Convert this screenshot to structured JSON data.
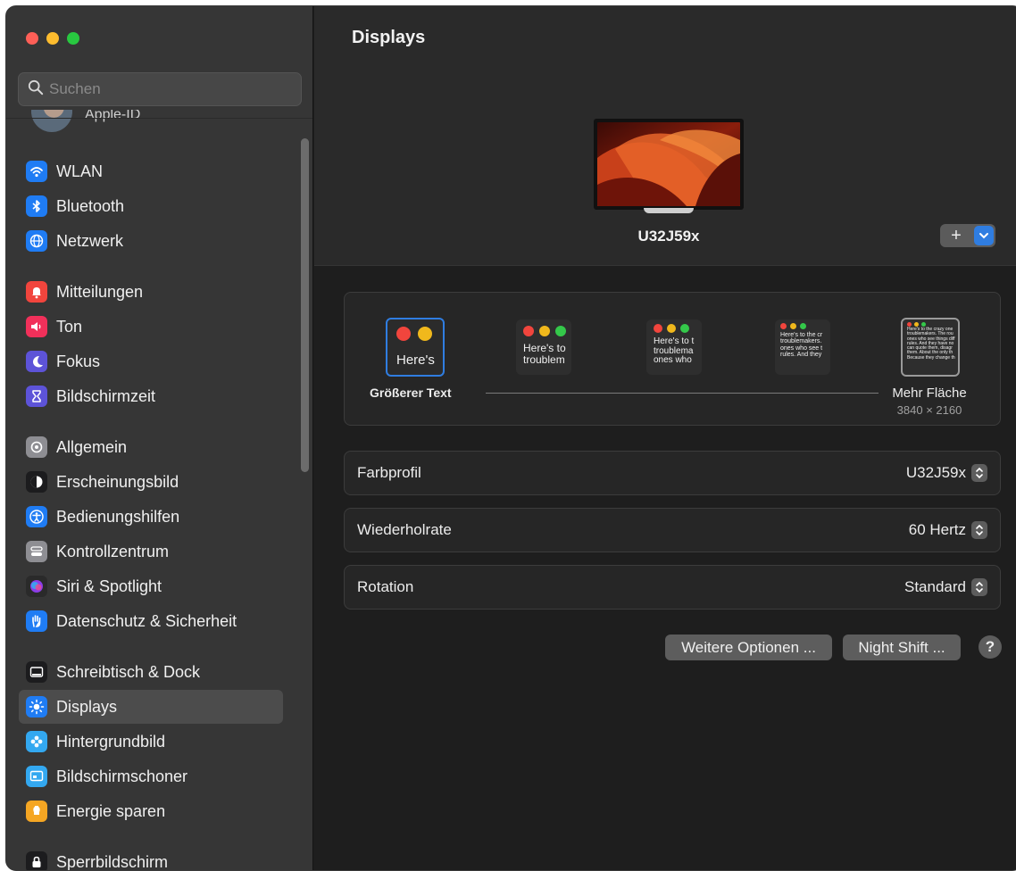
{
  "window": {
    "title": "Displays"
  },
  "sidebar": {
    "search_placeholder": "Suchen",
    "apple_id_label": "Apple-ID",
    "items": [
      {
        "label": "WLAN",
        "icon": "wifi-icon",
        "color": "#1f7cf4"
      },
      {
        "label": "Bluetooth",
        "icon": "bluetooth-icon",
        "color": "#1f7cf4"
      },
      {
        "label": "Netzwerk",
        "icon": "globe-icon",
        "color": "#1f7cf4"
      },
      {
        "label": "Mitteilungen",
        "icon": "bell-icon",
        "color": "#f1453d"
      },
      {
        "label": "Ton",
        "icon": "speaker-icon",
        "color": "#f1305a"
      },
      {
        "label": "Fokus",
        "icon": "moon-icon",
        "color": "#5d53d8"
      },
      {
        "label": "Bildschirmzeit",
        "icon": "hourglass-icon",
        "color": "#5d53d8"
      },
      {
        "label": "Allgemein",
        "icon": "gear-icon",
        "color": "#8e8e93"
      },
      {
        "label": "Erscheinungsbild",
        "icon": "appearance-icon",
        "color": "#1c1c1e"
      },
      {
        "label": "Bedienungshilfen",
        "icon": "accessibility-icon",
        "color": "#1f7cf4"
      },
      {
        "label": "Kontrollzentrum",
        "icon": "toggles-icon",
        "color": "#8e8e93"
      },
      {
        "label": "Siri & Spotlight",
        "icon": "siri-icon",
        "color": "#2a2a2a"
      },
      {
        "label": "Datenschutz & Sicherheit",
        "icon": "hand-icon",
        "color": "#1f7cf4"
      },
      {
        "label": "Schreibtisch & Dock",
        "icon": "dock-icon",
        "color": "#1c1c1e"
      },
      {
        "label": "Displays",
        "icon": "sun-icon",
        "color": "#1f7cf4"
      },
      {
        "label": "Hintergrundbild",
        "icon": "flower-icon",
        "color": "#33a8f0"
      },
      {
        "label": "Bildschirmschoner",
        "icon": "screensaver-icon",
        "color": "#33a8f0"
      },
      {
        "label": "Energie sparen",
        "icon": "battery-icon",
        "color": "#f5a623"
      },
      {
        "label": "Sperrbildschirm",
        "icon": "lock-icon",
        "color": "#1c1c1e"
      }
    ]
  },
  "main": {
    "title": "Displays",
    "monitor_name": "U32J59x",
    "add_button": "+",
    "scaling": {
      "left_label": "Größerer Text",
      "right_label": "Mehr Fläche",
      "resolution": "3840 × 2160",
      "thumbs": [
        {
          "text": "Here's"
        },
        {
          "text": "Here's to\ntroublem"
        },
        {
          "text": "Here's to t\ntroublema\nones who"
        },
        {
          "text": "Here's to the cr\ntroublemakers.\nones who see t\nrules. And they"
        },
        {
          "text": "Here's to the crazy one\ntroublemakers. The rou\nones who see things diff\nrules. And they have no\ncan quote them, disagr\nthem. About the only th\nBecause they change th"
        }
      ]
    },
    "rows": [
      {
        "label": "Farbprofil",
        "value": "U32J59x"
      },
      {
        "label": "Wiederholrate",
        "value": "60 Hertz"
      },
      {
        "label": "Rotation",
        "value": "Standard"
      }
    ],
    "buttons": {
      "more_options": "Weitere Optionen ...",
      "night_shift": "Night Shift ...",
      "help": "?"
    }
  }
}
